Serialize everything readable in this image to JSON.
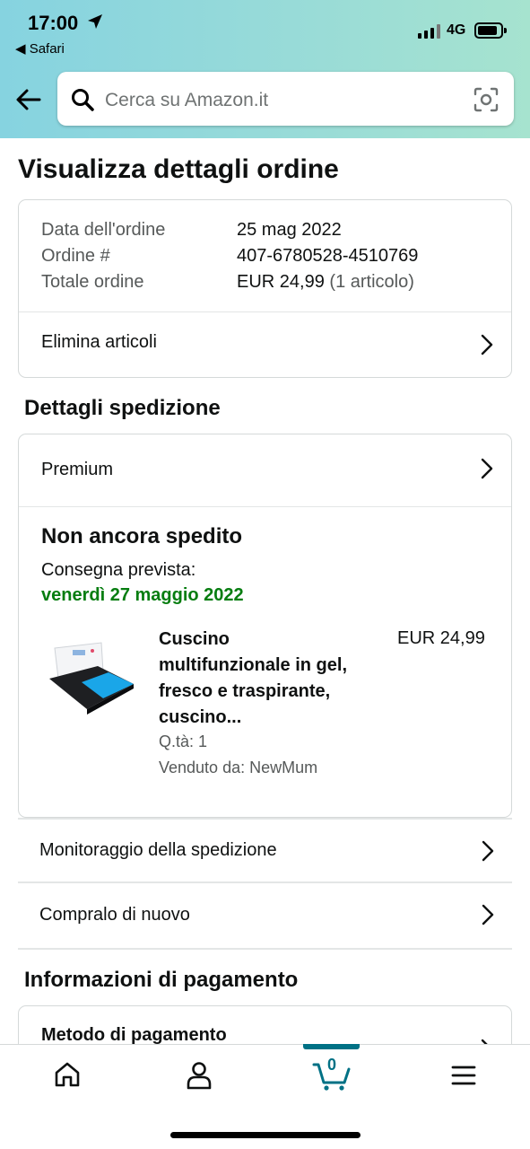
{
  "status_bar": {
    "time": "17:00",
    "back_app": "◀ Safari",
    "network": "4G"
  },
  "search": {
    "placeholder": "Cerca su Amazon.it"
  },
  "page": {
    "title": "Visualizza dettagli ordine"
  },
  "order_summary": {
    "date_label": "Data dell'ordine",
    "date_value": "25 mag 2022",
    "number_label": "Ordine #",
    "number_value": "407-6780528-4510769",
    "total_label": "Totale ordine",
    "total_value": "EUR 24,99",
    "total_items": "(1 articolo)",
    "delete_items": "Elimina articoli"
  },
  "shipping": {
    "section_title": "Dettagli spedizione",
    "service": "Premium",
    "status": "Non ancora spedito",
    "delivery_label": "Consegna prevista:",
    "delivery_date": "venerdì 27 maggio 2022",
    "item": {
      "title_lines": [
        "Cuscino",
        "multifunzionale in gel,",
        "fresco e traspirante,",
        "cuscino..."
      ],
      "price": "EUR 24,99",
      "qty": "Q.tà: 1",
      "seller": "Venduto da: NewMum"
    }
  },
  "actions": {
    "track": "Monitoraggio della spedizione",
    "buy_again": "Compralo di nuovo"
  },
  "payment": {
    "section_title": "Informazioni di pagamento",
    "method": "Metodo di pagamento"
  },
  "bottom_nav": {
    "cart_count": "0",
    "active_tab": "cart",
    "accent_color": "#007185"
  },
  "colors": {
    "delivery_green": "#067d10",
    "header_gradient": [
      "#86d3e0",
      "#a6e3cf"
    ]
  }
}
